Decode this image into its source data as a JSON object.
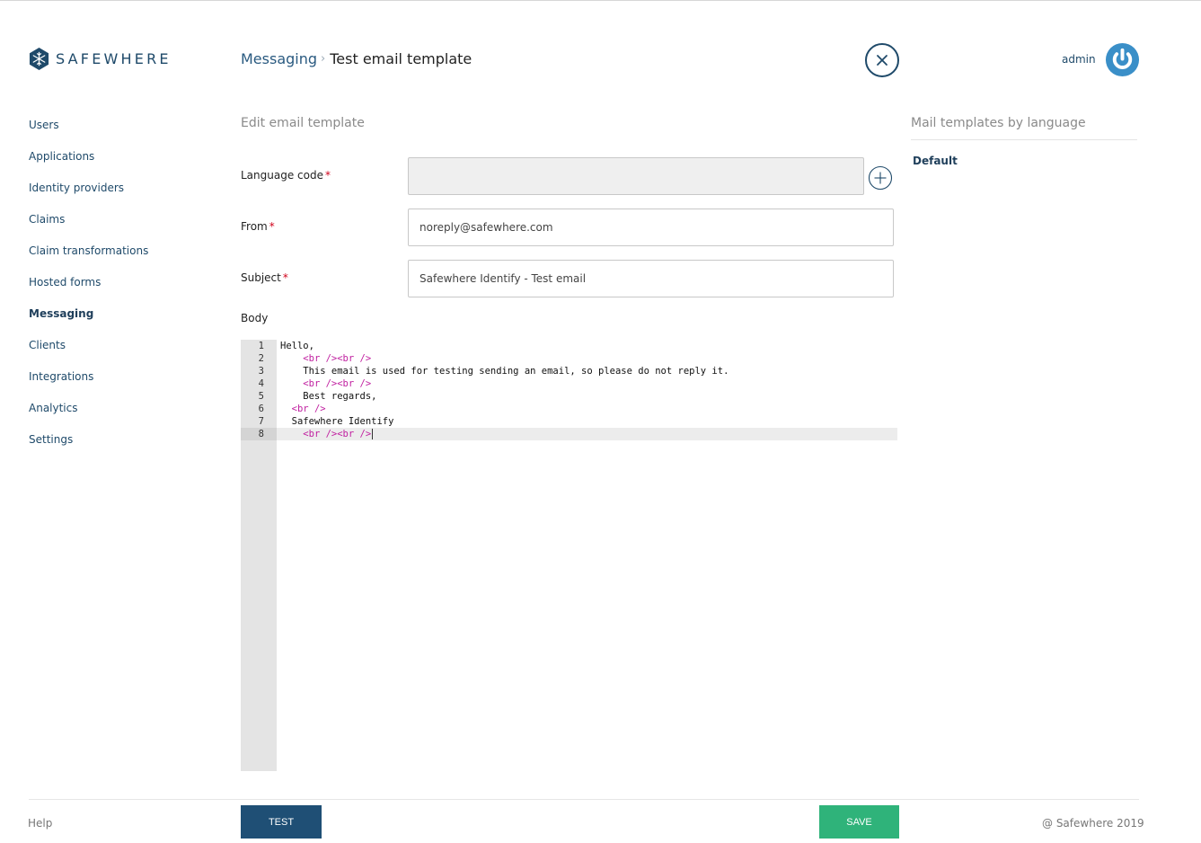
{
  "brand": {
    "name": "SAFEWHERE",
    "primary_color": "#1f4a6a"
  },
  "breadcrumb": {
    "parent": "Messaging",
    "separator": "›",
    "current": "Test email template"
  },
  "user": {
    "name": "admin"
  },
  "sidebar": {
    "items": [
      {
        "label": "Users",
        "active": false
      },
      {
        "label": "Applications",
        "active": false
      },
      {
        "label": "Identity providers",
        "active": false
      },
      {
        "label": "Claims",
        "active": false
      },
      {
        "label": "Claim transformations",
        "active": false
      },
      {
        "label": "Hosted forms",
        "active": false
      },
      {
        "label": "Messaging",
        "active": true
      },
      {
        "label": "Clients",
        "active": false
      },
      {
        "label": "Integrations",
        "active": false
      },
      {
        "label": "Analytics",
        "active": false
      },
      {
        "label": "Settings",
        "active": false
      }
    ]
  },
  "form": {
    "title": "Edit email template",
    "language_code": {
      "label": "Language code",
      "required_mark": "*",
      "value": ""
    },
    "from": {
      "label": "From",
      "required_mark": "*",
      "value": "noreply@safewhere.com"
    },
    "subject": {
      "label": "Subject",
      "required_mark": "*",
      "value": "Safewhere Identify - Test email"
    },
    "body": {
      "label": "Body"
    }
  },
  "editor": {
    "current_line": 8,
    "lines": [
      {
        "n": "1",
        "indent": "",
        "text": "Hello,",
        "tag": ""
      },
      {
        "n": "2",
        "indent": "    ",
        "text": "",
        "tag": "<br /><br />"
      },
      {
        "n": "3",
        "indent": "    ",
        "text": "This email is used for testing sending an email, so please do not reply it.",
        "tag": ""
      },
      {
        "n": "4",
        "indent": "    ",
        "text": "",
        "tag": "<br /><br />"
      },
      {
        "n": "5",
        "indent": "    ",
        "text": "Best regards,",
        "tag": ""
      },
      {
        "n": "6",
        "indent": "  ",
        "text": "",
        "tag": "<br />"
      },
      {
        "n": "7",
        "indent": "  ",
        "text": "Safewhere Identify",
        "tag": ""
      },
      {
        "n": "8",
        "indent": "    ",
        "text": "",
        "tag": "<br /><br />"
      }
    ]
  },
  "right_panel": {
    "title": "Mail templates by language",
    "languages": [
      "Default"
    ]
  },
  "footer": {
    "help": "Help",
    "copyright": "@ Safewhere 2019",
    "test_label": "TEST",
    "save_label": "SAVE"
  },
  "colors": {
    "save": "#2fb37a",
    "test": "#1f4f75",
    "tag": "#c020a0",
    "required": "#d0021b"
  }
}
